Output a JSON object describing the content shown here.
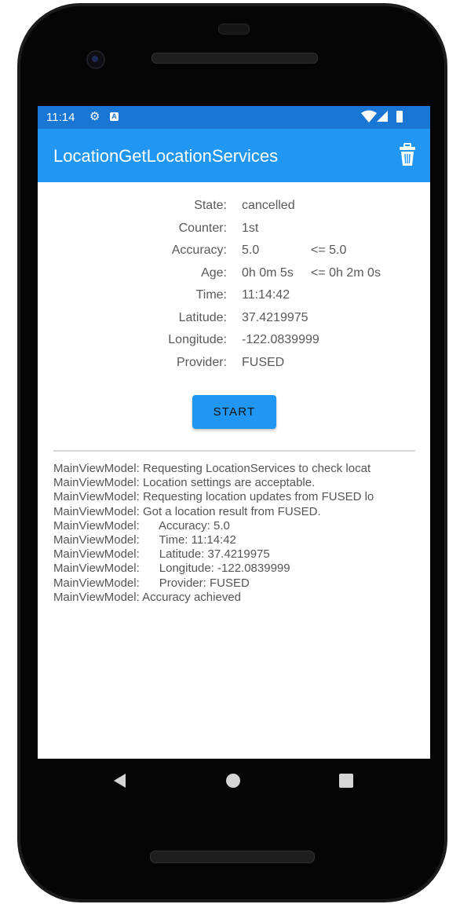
{
  "status_bar": {
    "time": "11:14",
    "icons": [
      "gear-icon",
      "a-notification-icon",
      "wifi-icon",
      "signal-icon",
      "battery-icon"
    ]
  },
  "app_bar": {
    "title": "LocationGetLocationServices",
    "action_icon": "trash-icon"
  },
  "info": {
    "state": {
      "label": "State:",
      "value": "cancelled"
    },
    "counter": {
      "label": "Counter:",
      "value": "1st"
    },
    "accuracy": {
      "label": "Accuracy:",
      "value": "5.0",
      "target": "<= 5.0"
    },
    "age": {
      "label": "Age:",
      "value": "0h 0m 5s",
      "target": "<= 0h 2m 0s"
    },
    "time": {
      "label": "Time:",
      "value": "11:14:42"
    },
    "latitude": {
      "label": "Latitude:",
      "value": "37.4219975"
    },
    "longitude": {
      "label": "Longitude:",
      "value": "-122.0839999"
    },
    "provider": {
      "label": "Provider:",
      "value": "FUSED"
    }
  },
  "start_button": {
    "label": "START"
  },
  "log": [
    "MainViewModel: Requesting LocationServices to check locat",
    "MainViewModel: Location settings are acceptable.",
    "MainViewModel: Requesting location updates from FUSED lo",
    "MainViewModel: Got a location result from FUSED.",
    "MainViewModel:      Accuracy: 5.0",
    "MainViewModel:      Time: 11:14:42",
    "MainViewModel:      Latitude: 37.4219975",
    "MainViewModel:      Longitude: -122.0839999",
    "MainViewModel:      Provider: FUSED",
    "MainViewModel: Accuracy achieved"
  ],
  "nav": {
    "icons": [
      "back-icon",
      "home-icon",
      "recents-icon"
    ]
  },
  "colors": {
    "status_bar": "#1976d2",
    "app_bar": "#2196f3",
    "button": "#2196f3"
  }
}
